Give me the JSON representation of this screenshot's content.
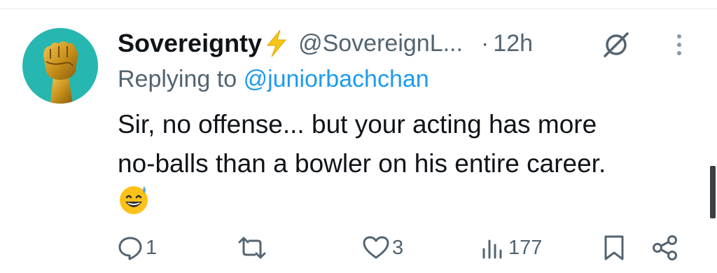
{
  "tweet": {
    "display_name": "Sovereignty",
    "name_badge": "lightning-bolt-emoji",
    "handle": "@SovereignL...",
    "separator": "·",
    "time": "12h",
    "reply_prefix": "Replying to",
    "reply_to": "@juniorbachchan",
    "text_lines": [
      "Sir, no offense... but your acting has more",
      "no-balls than a bowler on his entire career."
    ],
    "emoji": "sweat-smile-emoji"
  },
  "actions": {
    "reply_count": "1",
    "retweet_count": "",
    "like_count": "3",
    "views_count": "177"
  },
  "colors": {
    "text": "#0f1419",
    "secondary": "#536471",
    "link": "#1d9bf0",
    "avatar_bg": "#25b7b0",
    "bolt": "#f5c518"
  },
  "icons": [
    "grok-icon",
    "more-vertical-icon",
    "reply-icon",
    "retweet-icon",
    "like-icon",
    "views-icon",
    "bookmark-icon",
    "share-icon"
  ]
}
